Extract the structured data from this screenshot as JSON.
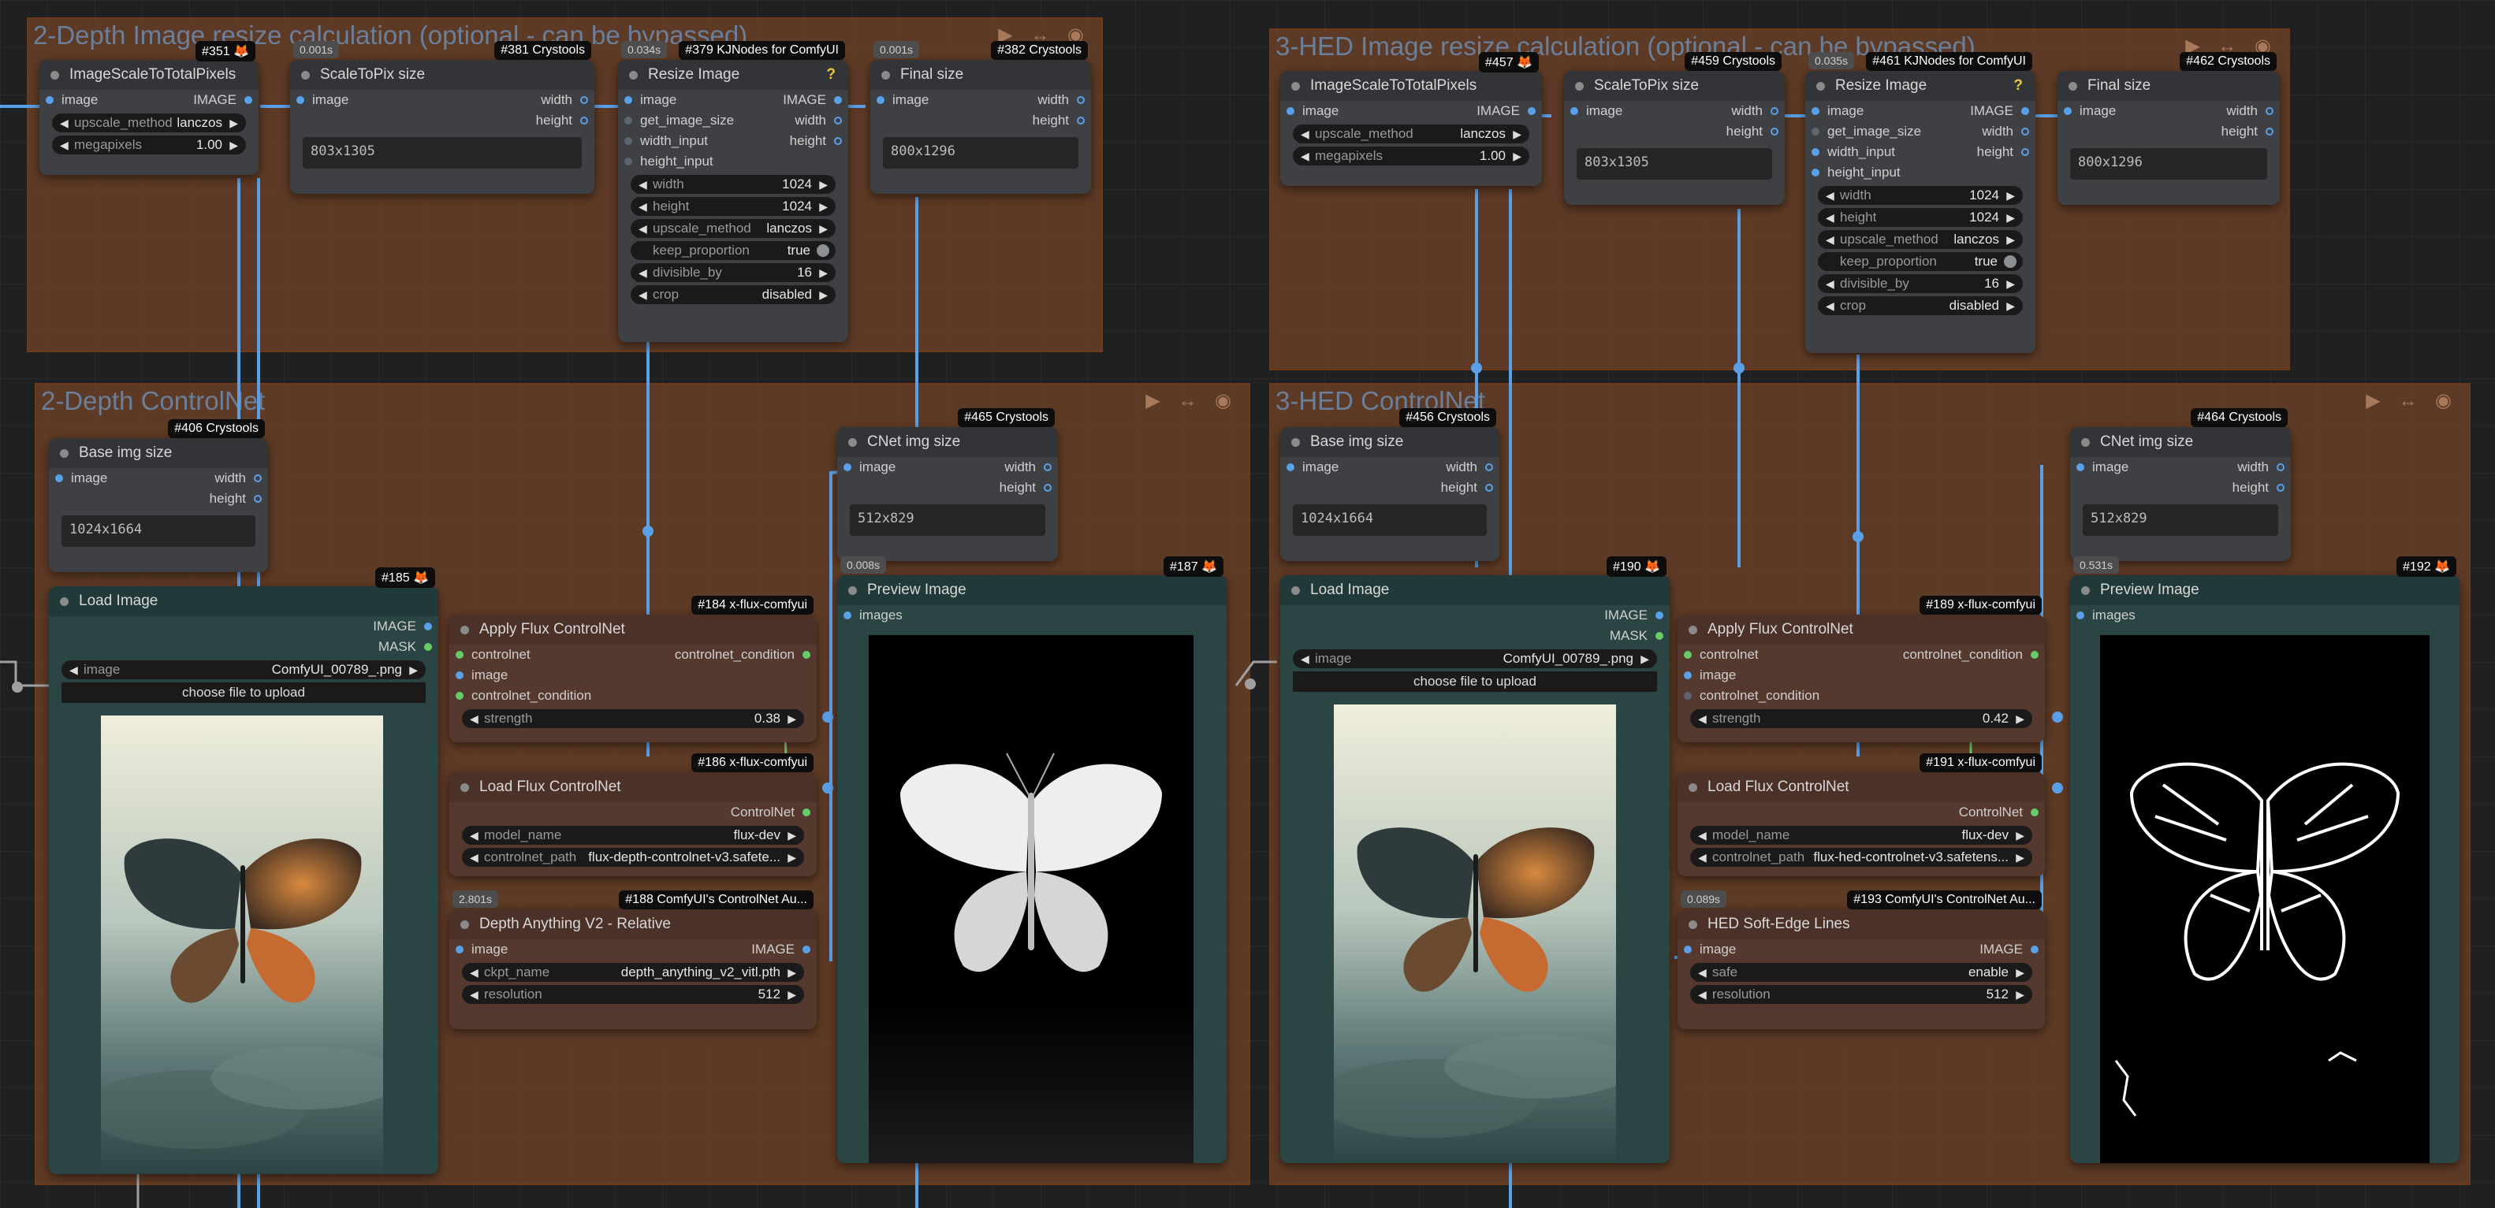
{
  "groups": {
    "g1": {
      "title": "2-Depth Image resize calculation (optional - can be bypassed)"
    },
    "g2": {
      "title": "3-HED Image resize calculation (optional - can be bypassed)"
    },
    "g3": {
      "title": "2-Depth ControlNet"
    },
    "g4": {
      "title": "3-HED ControlNet"
    },
    "controls": "▶ ↔ ◉"
  },
  "common": {
    "image": "image",
    "IMAGE": "IMAGE",
    "width": "width",
    "height": "height",
    "MASK": "MASK",
    "images": "images",
    "get_image_size": "get_image_size",
    "width_input": "width_input",
    "height_input": "height_input",
    "upscale_method": "upscale_method",
    "megapixels": "megapixels",
    "keep_proportion": "keep_proportion",
    "divisible_by": "divisible_by",
    "crop": "crop",
    "strength": "strength",
    "controlnet": "controlnet",
    "controlnet_condition": "controlnet_condition",
    "ControlNet": "ControlNet",
    "model_name": "model_name",
    "controlnet_path": "controlnet_path",
    "ckpt_name": "ckpt_name",
    "resolution": "resolution",
    "safe": "safe",
    "choose_file": "choose file to upload",
    "help": "?",
    "arrow_l": "◀",
    "arrow_r": "▶"
  },
  "nodes": {
    "n351": {
      "title": "ImageScaleToTotalPixels",
      "badge": "#351 🦊",
      "upscale_method": "lanczos",
      "megapixels": "1.00"
    },
    "n381": {
      "title": "ScaleToPix size",
      "badge": "#381 Crystools",
      "timing": "0.001s",
      "text": "803x1305"
    },
    "n379": {
      "title": "Resize Image",
      "badge": "#379 KJNodes for ComfyUI",
      "timing": "0.034s",
      "width": "1024",
      "height": "1024",
      "upscale_method": "lanczos",
      "keep_proportion": "true",
      "divisible_by": "16",
      "crop": "disabled"
    },
    "n382": {
      "title": "Final size",
      "badge": "#382 Crystools",
      "timing": "0.001s",
      "text": "800x1296"
    },
    "n457": {
      "title": "ImageScaleToTotalPixels",
      "badge": "#457 🦊",
      "upscale_method": "lanczos",
      "megapixels": "1.00"
    },
    "n459": {
      "title": "ScaleToPix size",
      "badge": "#459 Crystools",
      "text": "803x1305"
    },
    "n461": {
      "title": "Resize Image",
      "badge": "#461 KJNodes for ComfyUI",
      "timing": "0.035s",
      "width": "1024",
      "height": "1024",
      "upscale_method": "lanczos",
      "keep_proportion": "true",
      "divisible_by": "16",
      "crop": "disabled"
    },
    "n462": {
      "title": "Final size",
      "badge": "#462 Crystools",
      "text": "800x1296"
    },
    "n406": {
      "title": "Base img size",
      "badge": "#406 Crystools",
      "text": "1024x1664"
    },
    "n465": {
      "title": "CNet img size",
      "badge": "#465 Crystools",
      "text": "512x829"
    },
    "n185": {
      "title": "Load Image",
      "badge": "#185 🦊",
      "image": "ComfyUI_00789_.png"
    },
    "n184": {
      "title": "Apply Flux ControlNet",
      "badge": "#184 x-flux-comfyui",
      "strength": "0.38"
    },
    "n186": {
      "title": "Load Flux ControlNet",
      "badge": "#186 x-flux-comfyui",
      "model_name": "flux-dev",
      "controlnet_path": "flux-depth-controlnet-v3.safete..."
    },
    "n188": {
      "title": "Depth Anything V2 - Relative",
      "badge": "#188 ComfyUI's ControlNet Au...",
      "timing": "2.801s",
      "ckpt_name": "depth_anything_v2_vitl.pth",
      "resolution": "512"
    },
    "n187": {
      "title": "Preview Image",
      "badge": "#187 🦊",
      "timing": "0.008s"
    },
    "n456": {
      "title": "Base img size",
      "badge": "#456 Crystools",
      "text": "1024x1664"
    },
    "n464": {
      "title": "CNet img size",
      "badge": "#464 Crystools",
      "text": "512x829"
    },
    "n190": {
      "title": "Load Image",
      "badge": "#190 🦊",
      "image": "ComfyUI_00789_.png"
    },
    "n189": {
      "title": "Apply Flux ControlNet",
      "badge": "#189 x-flux-comfyui",
      "strength": "0.42"
    },
    "n191": {
      "title": "Load Flux ControlNet",
      "badge": "#191 x-flux-comfyui",
      "model_name": "flux-dev",
      "controlnet_path": "flux-hed-controlnet-v3.safetens..."
    },
    "n193": {
      "title": "HED Soft-Edge Lines",
      "badge": "#193 ComfyUI's ControlNet Au...",
      "timing": "0.089s",
      "safe": "enable",
      "resolution": "512"
    },
    "n192": {
      "title": "Preview Image",
      "badge": "#192 🦊",
      "timing": "0.531s"
    }
  }
}
